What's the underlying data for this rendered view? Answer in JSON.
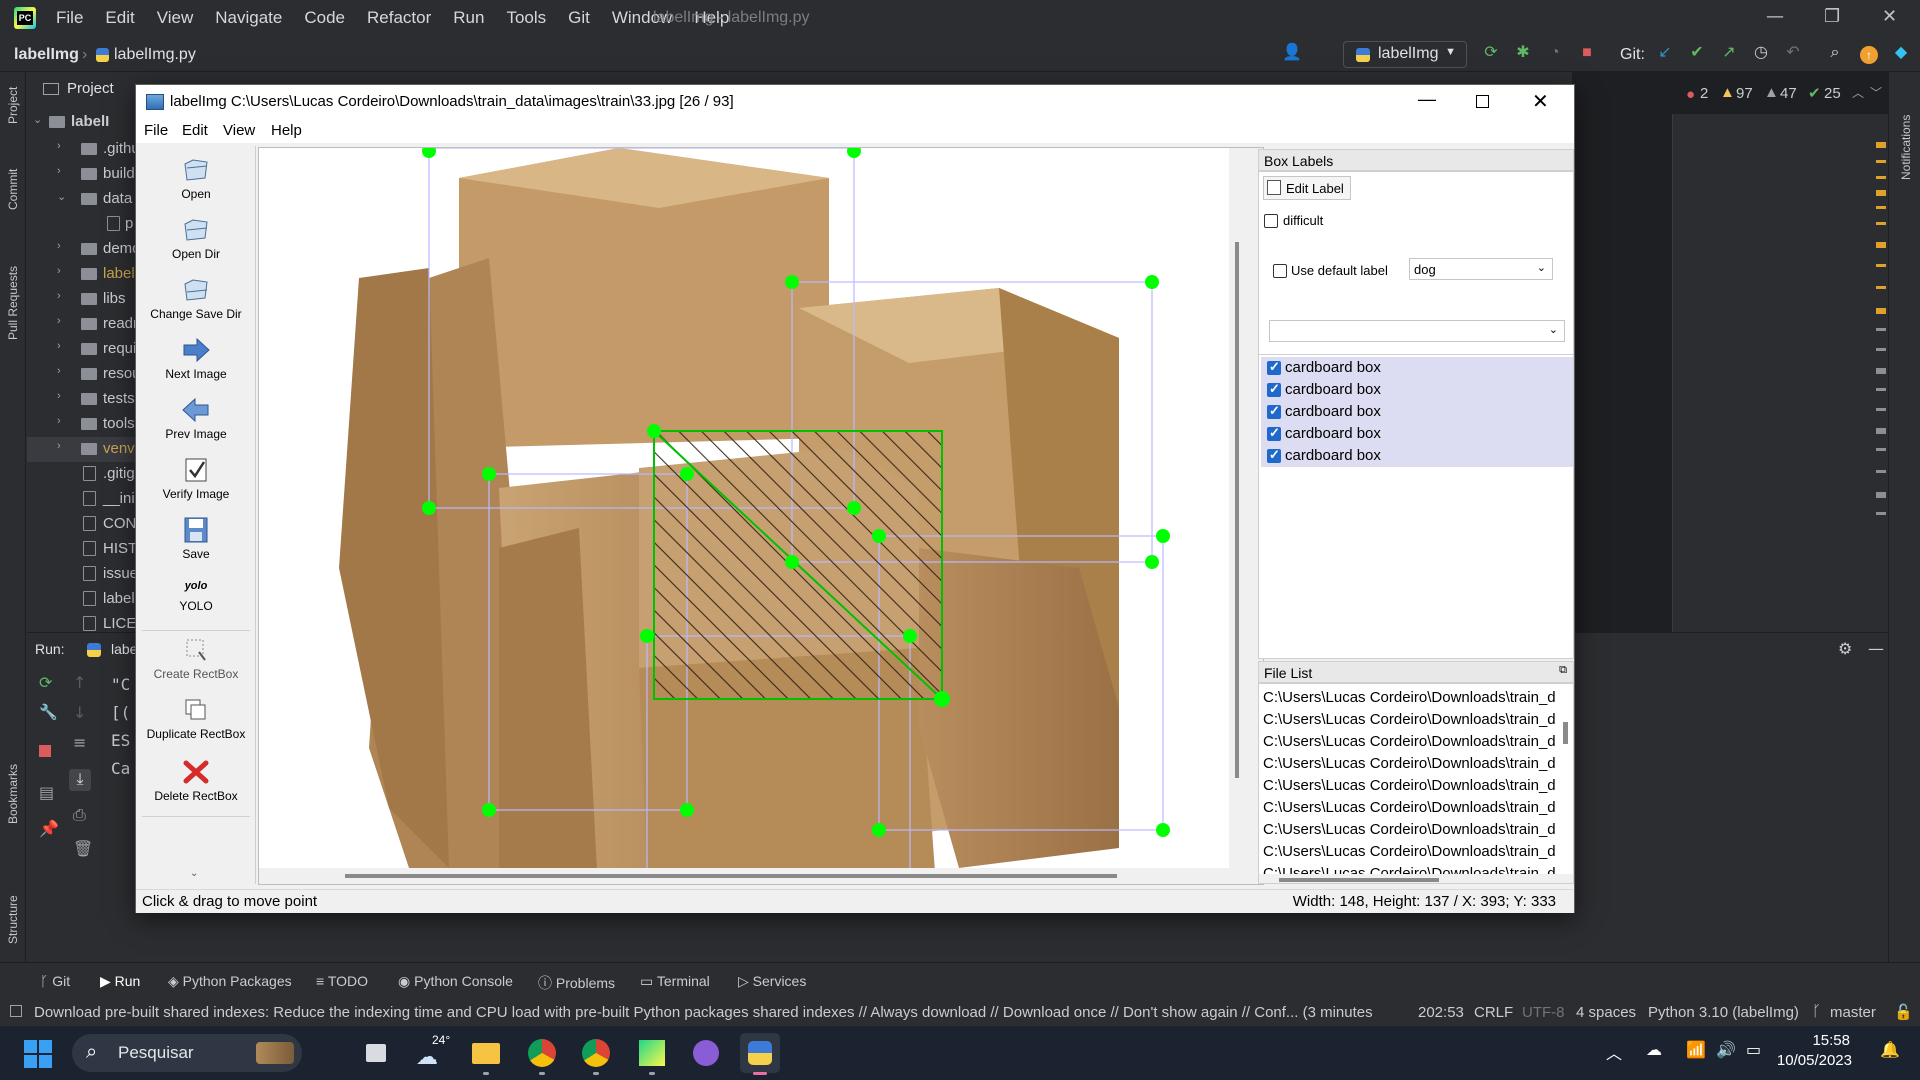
{
  "ide": {
    "menu": [
      "File",
      "Edit",
      "View",
      "Navigate",
      "Code",
      "Refactor",
      "Run",
      "Tools",
      "Git",
      "Window",
      "Help"
    ],
    "window_title": "labelImg - labelImg.py",
    "breadcrumb_project": "labelImg",
    "breadcrumb_file": "labelImg.py",
    "run_config": "labelImg",
    "git_label": "Git:",
    "project_header": "Project",
    "tree": [
      {
        "label": "labelI",
        "kind": "root"
      },
      {
        "label": ".githu",
        "kind": "folder"
      },
      {
        "label": "build",
        "kind": "folder"
      },
      {
        "label": "data",
        "kind": "folder-open"
      },
      {
        "label": "p",
        "kind": "file"
      },
      {
        "label": "demo",
        "kind": "folder"
      },
      {
        "label": "label",
        "kind": "folder"
      },
      {
        "label": "libs",
        "kind": "folder"
      },
      {
        "label": "readm",
        "kind": "folder"
      },
      {
        "label": "requir",
        "kind": "folder"
      },
      {
        "label": "resou",
        "kind": "folder"
      },
      {
        "label": "tests",
        "kind": "folder"
      },
      {
        "label": "tools",
        "kind": "folder"
      },
      {
        "label": "venv",
        "kind": "folder"
      },
      {
        "label": ".gitig",
        "kind": "file"
      },
      {
        "label": "__init",
        "kind": "file"
      },
      {
        "label": "CON",
        "kind": "file"
      },
      {
        "label": "HIST",
        "kind": "file"
      },
      {
        "label": "issue",
        "kind": "file"
      },
      {
        "label": "label",
        "kind": "file"
      },
      {
        "label": "LICEN",
        "kind": "file"
      }
    ],
    "run_label": "Run:",
    "run_tab": "labe",
    "console_lines": [
      "\"C",
      "[(",
      "ES",
      "Ca"
    ],
    "inspections": {
      "errors": "2",
      "warnings": "97",
      "weak": "47",
      "ok": "25"
    },
    "left_stripe": [
      "Project",
      "Commit",
      "Pull Requests",
      "Bookmarks",
      "Structure"
    ],
    "right_stripe": [
      "Notifications"
    ],
    "bottom_tabs": [
      "Git",
      "Run",
      "Python Packages",
      "TODO",
      "Python Console",
      "Problems",
      "Terminal",
      "Services"
    ],
    "status_message": "Download pre-built shared indexes: Reduce the indexing time and CPU load with pre-built Python packages shared indexes // Always download // Download once // Don't show again // Conf... (3 minutes",
    "status_right": [
      "202:53",
      "CRLF",
      "UTF-8",
      "4 spaces",
      "Python 3.10 (labelImg)",
      "master"
    ]
  },
  "taskbar": {
    "search_placeholder": "Pesquisar",
    "weather": "24°",
    "time": "15:58",
    "date": "10/05/2023"
  },
  "labelimg": {
    "title": "labelImg C:\\Users\\Lucas Cordeiro\\Downloads\\train_data\\images\\train\\33.jpg [26 / 93]",
    "menu": [
      "File",
      "Edit",
      "View",
      "Help"
    ],
    "tools": [
      {
        "label": "Open",
        "icon": "open-icon"
      },
      {
        "label": "Open Dir",
        "icon": "open-dir-icon"
      },
      {
        "label": "Change Save Dir",
        "icon": "change-save-dir-icon"
      },
      {
        "label": "Next Image",
        "icon": "next-arrow-icon"
      },
      {
        "label": "Prev Image",
        "icon": "prev-arrow-icon"
      },
      {
        "label": "Verify Image",
        "icon": "verify-check-icon"
      },
      {
        "label": "Save",
        "icon": "save-floppy-icon"
      },
      {
        "label": "YOLO",
        "icon": "yolo-icon",
        "icon_text": "yolo"
      },
      {
        "label": "Create RectBox",
        "icon": "create-rectbox-icon"
      },
      {
        "label": "Duplicate RectBox",
        "icon": "duplicate-rectbox-icon"
      },
      {
        "label": "Delete RectBox",
        "icon": "delete-x-icon"
      }
    ],
    "box_labels_title": "Box Labels",
    "edit_label": "Edit Label",
    "difficult": "difficult",
    "use_default_label": "Use default label",
    "default_label_value": "dog",
    "label_filter_value": "",
    "labels": [
      "cardboard box",
      "cardboard box",
      "cardboard box",
      "cardboard box",
      "cardboard box"
    ],
    "file_list_title": "File List",
    "files": [
      "C:\\Users\\Lucas Cordeiro\\Downloads\\train_d",
      "C:\\Users\\Lucas Cordeiro\\Downloads\\train_d",
      "C:\\Users\\Lucas Cordeiro\\Downloads\\train_d",
      "C:\\Users\\Lucas Cordeiro\\Downloads\\train_d",
      "C:\\Users\\Lucas Cordeiro\\Downloads\\train_d",
      "C:\\Users\\Lucas Cordeiro\\Downloads\\train_d",
      "C:\\Users\\Lucas Cordeiro\\Downloads\\train_d",
      "C:\\Users\\Lucas Cordeiro\\Downloads\\train_d",
      "C:\\Users\\Lucas Cordeiro\\Downloads\\train_d"
    ],
    "status_left": "Click & drag to move point",
    "status_right": "Width: 148, Height: 137 / X: 393; Y: 333"
  },
  "colors": {
    "ide_bg": "#2b2d30",
    "vertex": "#00ff00",
    "box_line": "#b9b9ff",
    "selected_box": "#00c000",
    "label_row_bg": "#dcdcf2",
    "checkbox_blue": "#1e69c9"
  }
}
